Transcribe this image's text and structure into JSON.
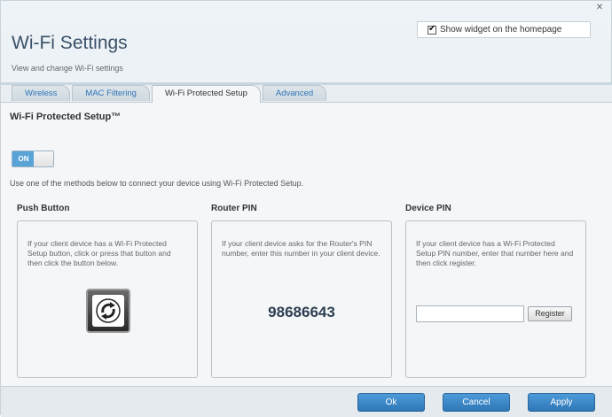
{
  "header": {
    "title": "Wi-Fi Settings",
    "subtitle": "View and change Wi-Fi settings",
    "close_icon": "close-icon",
    "widget_checkbox_label": "Show widget on the homepage",
    "widget_checked": true
  },
  "tabs": [
    {
      "label": "Wireless",
      "active": false
    },
    {
      "label": "MAC Filtering",
      "active": false
    },
    {
      "label": "Wi-Fi Protected Setup",
      "active": true
    },
    {
      "label": "Advanced",
      "active": false
    }
  ],
  "wps": {
    "section_title": "Wi-Fi Protected Setup™",
    "toggle_label": "ON",
    "toggle_on": true,
    "description": "Use one of the methods below to connect your device using Wi-Fi Protected Setup.",
    "push_button": {
      "title": "Push Button",
      "text": "If your client device has a Wi-Fi Protected Setup button, click or press that button and then click the button below.",
      "icon": "wps-icon"
    },
    "router_pin": {
      "title": "Router PIN",
      "text": "If your client device asks for the Router's PIN number, enter this number in your client device.",
      "pin": "98686643"
    },
    "device_pin": {
      "title": "Device PIN",
      "text": "If your client device has a Wi-Fi Protected Setup PIN number, enter that number here and then click register.",
      "input_value": "",
      "register_label": "Register"
    }
  },
  "footer": {
    "ok_label": "Ok",
    "cancel_label": "Cancel",
    "apply_label": "Apply"
  },
  "colors": {
    "accent": "#2f77b7",
    "toggle_on": "#5aa3d6",
    "title": "#3a5068"
  }
}
